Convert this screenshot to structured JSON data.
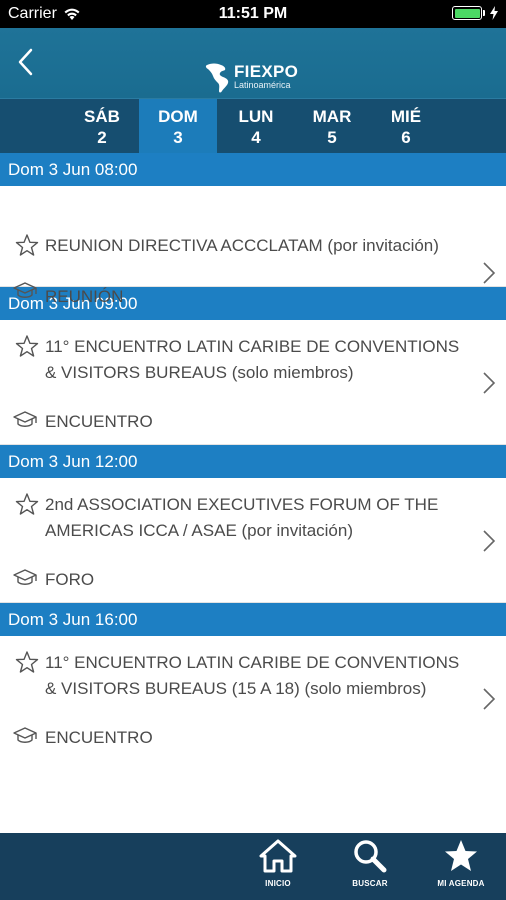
{
  "status_bar": {
    "carrier": "Carrier",
    "time": "11:51 PM",
    "battery_level": 1.0,
    "icons": [
      "wifi-icon",
      "battery-icon",
      "charging-bolt-icon"
    ]
  },
  "header": {
    "back_icon": "chevron-left-icon",
    "logo_title": "FIEXPO",
    "logo_subtitle": "Latinoamérica",
    "logo_icon": "americas-map-icon"
  },
  "day_tabs": [
    {
      "dow": "SÁB",
      "num": "2",
      "active": false
    },
    {
      "dow": "DOM",
      "num": "3",
      "active": true
    },
    {
      "dow": "LUN",
      "num": "4",
      "active": false
    },
    {
      "dow": "MAR",
      "num": "5",
      "active": false
    },
    {
      "dow": "MIÉ",
      "num": "6",
      "active": false
    }
  ],
  "sections": [
    {
      "header": "Dom 3 Jun 08:00",
      "events": [
        {
          "title": "REUNION DIRECTIVA ACCCLATAM (por invitación)",
          "type": "REUNIÓN",
          "starred": false
        }
      ]
    },
    {
      "header": "Dom 3 Jun 09:00",
      "events": [
        {
          "title": "11° ENCUENTRO LATIN CARIBE DE CONVENTIONS & VISITORS BUREAUS (solo miembros)",
          "type": "ENCUENTRO",
          "starred": false
        }
      ]
    },
    {
      "header": "Dom 3 Jun 12:00",
      "events": [
        {
          "title": "2nd ASSOCIATION EXECUTIVES FORUM OF THE AMERICAS ICCA / ASAE (por invitación)",
          "type": "FORO",
          "starred": false
        }
      ]
    },
    {
      "header": "Dom 3 Jun 16:00",
      "events": [
        {
          "title": "11° ENCUENTRO LATIN CARIBE DE CONVENTIONS & VISITORS BUREAUS (15 A 18) (solo miembros)",
          "type": "ENCUENTRO",
          "starred": false
        }
      ]
    }
  ],
  "tabbar": {
    "items": [
      {
        "label": "INICIO",
        "icon": "home-icon"
      },
      {
        "label": "BUSCAR",
        "icon": "search-icon"
      },
      {
        "label": "MI AGENDA",
        "icon": "star-filled-icon"
      }
    ]
  },
  "colors": {
    "header": "#1a6c90",
    "day_tabs_bg": "#164e70",
    "day_tab_active": "#1c7cba",
    "section_header": "#1d7fc3",
    "tabbar_bg": "#173f5c"
  }
}
